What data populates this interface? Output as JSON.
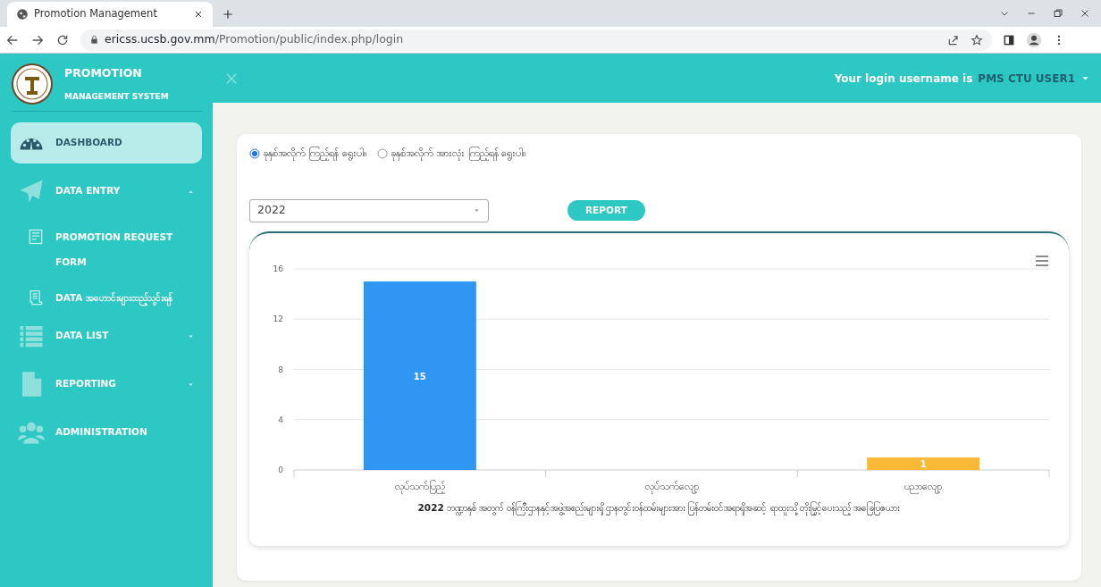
{
  "browser": {
    "tab_title": "Promotion Management",
    "url_host": "ericss.ucsb.gov.mm",
    "url_path": "/Promotion/public/index.php/login"
  },
  "sidebar": {
    "title": "PROMOTION",
    "subtitle": "MANAGEMENT SYSTEM",
    "items": [
      {
        "label": "DASHBOARD",
        "kind": "gauge",
        "selected": true
      },
      {
        "label": "DATA ENTRY",
        "kind": "plane",
        "selected": false,
        "expanded": true,
        "children": [
          {
            "label": "PROMOTION REQUEST FORM",
            "kind": "form",
            "selected": false
          },
          {
            "label": "DATA အဟောင်းများထည့်သွင်းရန်",
            "kind": "doc",
            "selected": false
          }
        ]
      },
      {
        "label": "DATA LIST",
        "kind": "list",
        "selected": false,
        "expanded": false
      },
      {
        "label": "REPORTING",
        "kind": "file",
        "selected": false,
        "expanded": false
      },
      {
        "label": "ADMINISTRATION",
        "kind": "people",
        "selected": false
      }
    ]
  },
  "topbar": {
    "username_prefix": "Your login username is",
    "username": "PMS CTU USER1"
  },
  "filter": {
    "radios": [
      {
        "label": "ခုနှစ်အလိုက် ကြည့်ရန် ရွေးပါ။",
        "selected": true
      },
      {
        "label": "ခုနှစ်အလိုက် အားလုံး ကြည့်ရန် ရွေးပါ။",
        "selected": false
      }
    ],
    "year_select": {
      "value": "2022"
    },
    "report_button": "REPORT"
  },
  "chart": {
    "chart_data": {
      "type": "bar",
      "title": "**2022** ဘဏ္ဍာနှစ် အတွက် ဝန်ကြီးဌာနနှင့်အဖွဲ့အစည်းများရှိ ဌာနတွင်းဝန်ထမ်းများအား ပြန်တမ်းဝင်အရာရှိအဆင့် ရာထူးသို့ တိုးမြှင့်ပေးသည့် အခြေပြဇယား",
      "categories": [
        "လုပ်သက်ပြည့်",
        "လုပ်သက်လျော့",
        "ပညာလျော့"
      ],
      "series": [
        {
          "values": [
            15,
            0,
            1
          ],
          "colors": [
            "#2f96f3",
            "#2f96f3",
            "#f7b936"
          ]
        }
      ],
      "ylim": [
        0,
        16
      ],
      "yticks": [
        0,
        4,
        8,
        12,
        16
      ],
      "grid": true,
      "value_labels": [
        "15",
        null,
        "1"
      ]
    }
  }
}
